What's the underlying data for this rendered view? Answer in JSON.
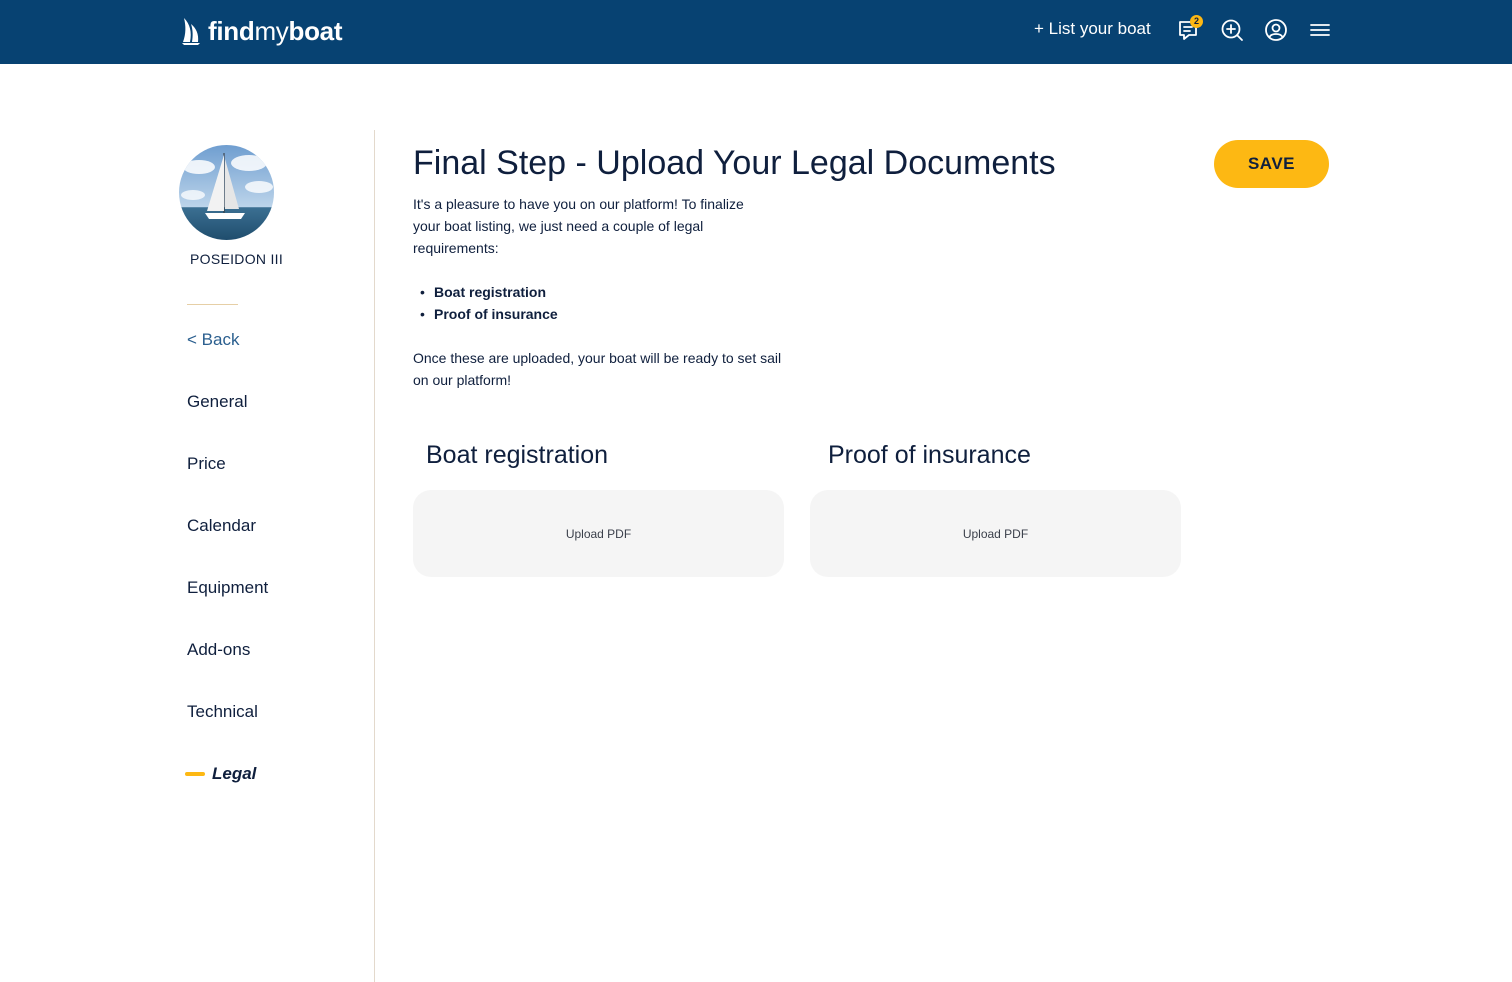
{
  "header": {
    "logo": {
      "find": "find",
      "my": "my",
      "boat": "boat"
    },
    "list_boat_label": "+ List your boat",
    "messages_badge": "2",
    "icons": [
      "messages-icon",
      "search-icon",
      "account-icon",
      "menu-icon"
    ]
  },
  "sidebar": {
    "boat_name": "POSEIDON III",
    "back_label": "< Back",
    "items": [
      {
        "label": "General"
      },
      {
        "label": "Price"
      },
      {
        "label": "Calendar"
      },
      {
        "label": "Equipment"
      },
      {
        "label": "Add-ons"
      },
      {
        "label": "Technical"
      },
      {
        "label": "Legal",
        "active": true
      }
    ]
  },
  "main": {
    "title": "Final Step - Upload Your Legal Documents",
    "save_label": "SAVE",
    "intro": "It's a pleasure to have you on our platform! To finalize your boat listing, we just need a couple of legal requirements:",
    "requirements": [
      "Boat registration",
      "Proof of insurance"
    ],
    "outro": "Once these are uploaded, your boat will be ready to set sail on our platform!",
    "uploads": [
      {
        "title": "Boat registration",
        "action_label": "Upload PDF"
      },
      {
        "title": "Proof of insurance",
        "action_label": "Upload PDF"
      }
    ]
  },
  "colors": {
    "header_bg": "#074272",
    "accent": "#fdb813",
    "text": "#0f1f3d",
    "upload_box_bg": "#f5f5f5"
  }
}
